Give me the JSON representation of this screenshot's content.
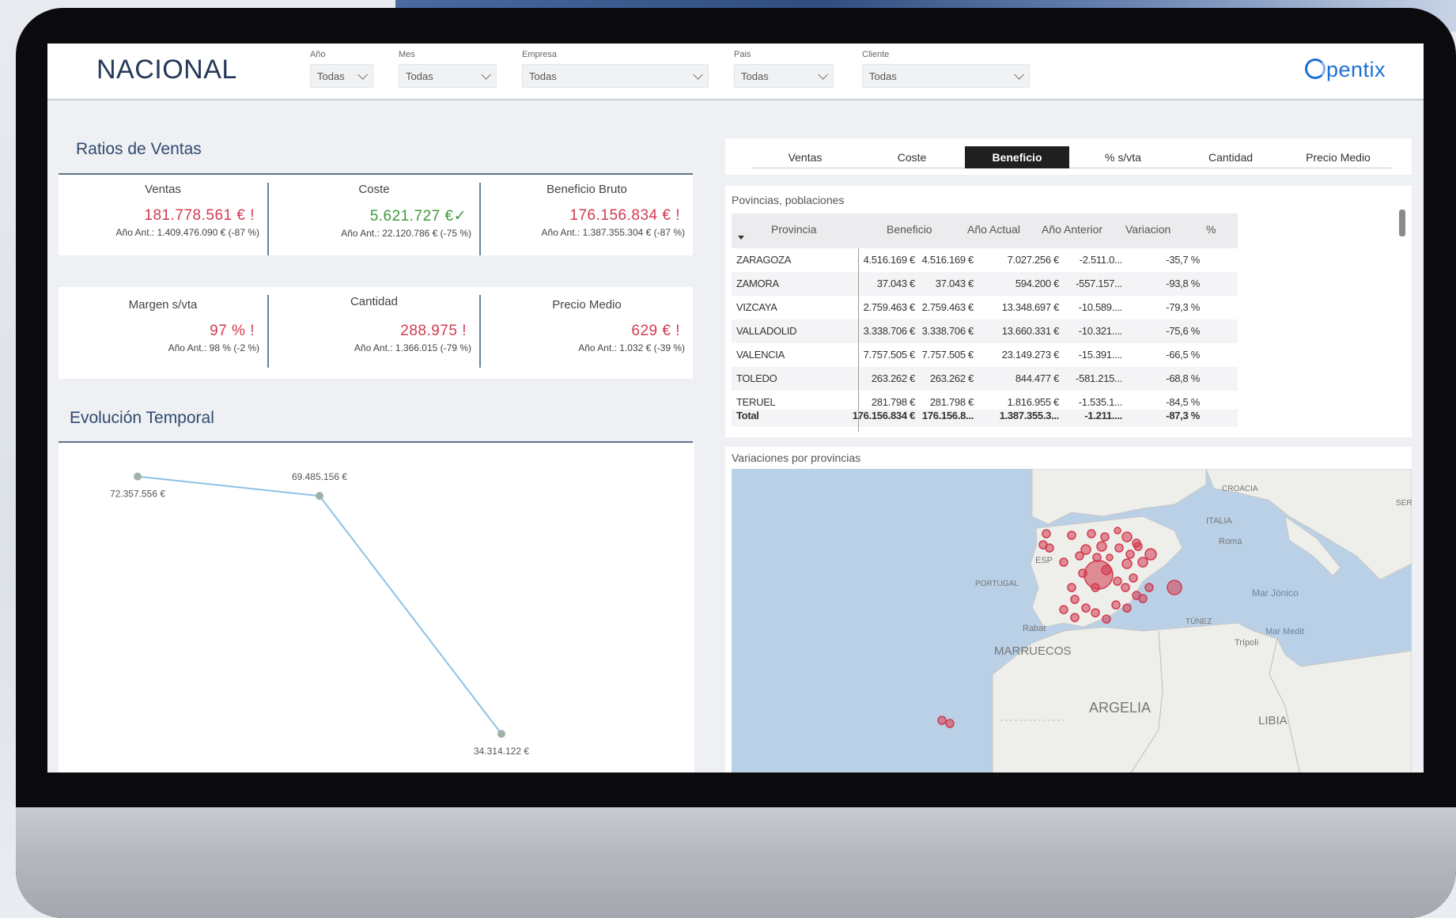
{
  "header": {
    "title": "NACIONAL",
    "slicers": [
      {
        "label": "Año",
        "value": "Todas"
      },
      {
        "label": "Mes",
        "value": "Todas"
      },
      {
        "label": "Empresa",
        "value": "Todas"
      },
      {
        "label": "Pais",
        "value": "Todas"
      },
      {
        "label": "Cliente",
        "value": "Todas"
      }
    ],
    "logo": "pentix",
    "brand_color": "#1c6fd1"
  },
  "ratios": {
    "title": "Ratios de Ventas",
    "row1": [
      {
        "title": "Ventas",
        "value": "181.778.561 € !",
        "sub": "Año Ant.: 1.409.476.090 € (-87 %)",
        "status": "bad"
      },
      {
        "title": "Coste",
        "value": "5.621.727 €✓",
        "sub": "Año Ant.: 22.120.786 € (-75 %)",
        "status": "good"
      },
      {
        "title": "Beneficio Bruto",
        "value": "176.156.834 € !",
        "sub": "Año Ant.: 1.387.355.304 € (-87 %)",
        "status": "bad"
      }
    ],
    "row2": [
      {
        "title": "Margen s/vta",
        "value": "97 % !",
        "sub": "Año Ant.: 98 % (-2 %)",
        "status": "bad"
      },
      {
        "title": "Cantidad",
        "value": "288.975 !",
        "sub": "Año Ant.: 1.366.015 (-79 %)",
        "status": "bad"
      },
      {
        "title": "Precio Medio",
        "value": "629 € !",
        "sub": "Año Ant.: 1.032 € (-39 %)",
        "status": "bad"
      }
    ],
    "colors": {
      "bad": "#d23a4f",
      "good": "#3f9a3a"
    }
  },
  "evolution": {
    "title": "Evolución Temporal"
  },
  "chart_data": {
    "type": "line",
    "title": "Evolución Temporal",
    "x": [
      1,
      2,
      3
    ],
    "series": [
      {
        "values": [
          72357556,
          69485156,
          34314122
        ],
        "labels": [
          "72.357.556 €",
          "69.485.156 €",
          "34.314.122 €"
        ]
      }
    ],
    "ylim": [
      30000000,
      75000000
    ],
    "color": "#8fc1e3"
  },
  "tabs": [
    "Ventas",
    "Coste",
    "Beneficio",
    "% s/vta",
    "Cantidad",
    "Precio Medio"
  ],
  "active_tab": "Beneficio",
  "table": {
    "caption": "Povincias, poblaciones",
    "headers": [
      "Provincia",
      "Beneficio",
      "Año Actual",
      "Año Anterior",
      "Variacion",
      "%"
    ],
    "rows": [
      [
        "ZARAGOZA",
        "4.516.169 €",
        "4.516.169 €",
        "7.027.256 €",
        "-2.511.0...",
        "-35,7 %"
      ],
      [
        "ZAMORA",
        "37.043 €",
        "37.043 €",
        "594.200 €",
        "-557.157...",
        "-93,8 %"
      ],
      [
        "VIZCAYA",
        "2.759.463 €",
        "2.759.463 €",
        "13.348.697 €",
        "-10.589....",
        "-79,3 %"
      ],
      [
        "VALLADOLID",
        "3.338.706 €",
        "3.338.706 €",
        "13.660.331 €",
        "-10.321....",
        "-75,6 %"
      ],
      [
        "VALENCIA",
        "7.757.505 €",
        "7.757.505 €",
        "23.149.273 €",
        "-15.391....",
        "-66,5 %"
      ],
      [
        "TOLEDO",
        "263.262 €",
        "263.262 €",
        "844.477 €",
        "-581.215...",
        "-68,8 %"
      ],
      [
        "TERUEL",
        "281.798 €",
        "281.798 €",
        "1.816.955 €",
        "-1.535.1...",
        "-84,5 %"
      ]
    ],
    "total": [
      "Total",
      "176.156.834 €",
      "176.156.8...",
      "1.387.355.3...",
      "-1.211....",
      "-87,3 %"
    ]
  },
  "map": {
    "caption": "Variaciones por provincias",
    "labels": [
      "CROACIA",
      "SERB",
      "ITALIA",
      "Roma",
      "Mar Jónico",
      "TÚNEZ",
      "Mar Medit",
      "Trípoli",
      "PORTUGAL",
      "ESP",
      "Rabat",
      "MARRUECOS",
      "ARGELIA",
      "LIBIA"
    ],
    "bubble_color": "#d23a4f"
  }
}
